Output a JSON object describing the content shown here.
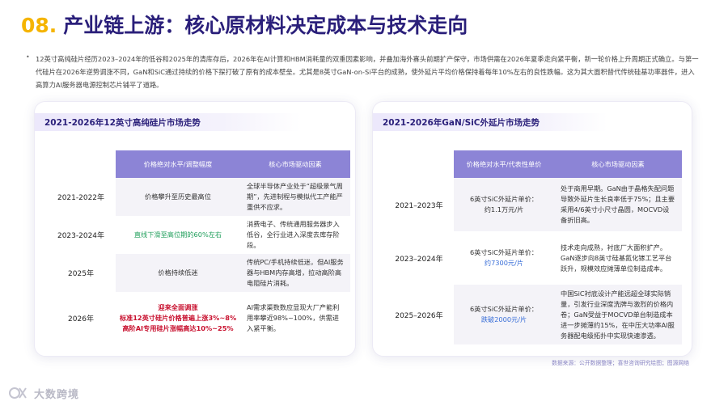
{
  "header": {
    "number": "08.",
    "title": "产业链上游：核心原材料决定成本与技术走向"
  },
  "intro": {
    "bullet": "•",
    "text": "12英寸高纯硅片经历2023–2024年的低谷和2025年的清库存后，2026年在AI计算和HBM消耗量的双重因素影响，并叠加海外寡头前期扩产保守，市场供需在2026年夏季走向紧平衡，新一轮价格上升周期正式确立。与第一代硅片在2026年逆势调涨不同，GaN和SiC通过持续的价格下探打破了原有的成本壁垒。尤其是8英寸GaN-on-Si平台的成熟，使外延片平均价格保持着每年10%左右的良性跌幅。这为其大面积替代传统硅基功率器件，进入高算力AI服务器电源控制芯片铺平了道路。"
  },
  "left": {
    "title": "2021-2026年12英寸高纯硅片市场走势",
    "headers": [
      "价格绝对水平/调整幅度",
      "核心市场驱动因素"
    ],
    "rows": [
      {
        "year": "2021-2022年",
        "value": "价格攀升至历史最高位",
        "driver": "全球半导体产业处于“超级景气周期”，先进制程与模拟代工产能严重供不应求。"
      },
      {
        "year": "2023-2024年",
        "value": "直线下滑至高位期的60%左右",
        "driver": "消费电子、传统通用服务器步入低谷，全行业进入深度去库存阶段。"
      },
      {
        "year": "2025年",
        "value": "价格持续低迷",
        "driver": "传统PC/手机持续低迷，但AI服务器与HBM内存高增，拉动高阶高电阻硅片消耗。"
      },
      {
        "year": "2026年",
        "value_lines": [
          "迎来全面调涨",
          "标准12英寸硅片价格普遍上涨3%~8%",
          "高阶AI专用硅片涨幅高达10%~25%"
        ],
        "driver": "AI需求渠数数应显现大厂产能利用率攀近98%~100%，供需进入紧平衡。"
      }
    ]
  },
  "right": {
    "title": "2021-2026年GaN/SiC外延片市场走势",
    "headers": [
      "价格绝对水平/代表性单价",
      "核心市场驱动因素"
    ],
    "rows": [
      {
        "year": "2021–2023年",
        "value_prefix": "6英寸SiC外延片单价：",
        "value_amount": "约1.1万元/片",
        "driver": "处于商用早期。GaN由于晶格失配问题导致外延片生长良率低于75%；且主要采用4/6英寸小尺寸晶圆，MOCVD设备折旧高。"
      },
      {
        "year": "2023–2024年",
        "value_prefix": "6英寸SiC外延片单价：",
        "value_amount": "约7300元/片",
        "driver": "技术走向成熟，衬底厂大面积扩产。GaN逐步向8英寸硅基氮化镓工艺平台跃升，规模效应摊薄单位制造成本。"
      },
      {
        "year": "2025–2026年",
        "value_prefix": "6英寸SiC外延片单价：",
        "value_amount": "跌破2000元/片",
        "driver": "中国SiC衬底设计产能远超全球实际销量，引发行业深度洗牌与激烈的价格内卷；GaN受益于MOCVD单台制造成本进一步摊薄约15%，在中压大功率AI服务器配电级拓扑中实现快速渗透。"
      }
    ]
  },
  "footer": {
    "source": "数据来源：公开数据整理；喜世咨询研究绘图；图源网络",
    "logo_text": "大数跨境"
  },
  "colors": {
    "title": "#2a1f7a",
    "accent_yellow": "#f5b400",
    "header_purple": "#8c84d6",
    "green": "#1e9e5a",
    "red": "#c8102e",
    "blue_value": "#3a6fd8"
  }
}
